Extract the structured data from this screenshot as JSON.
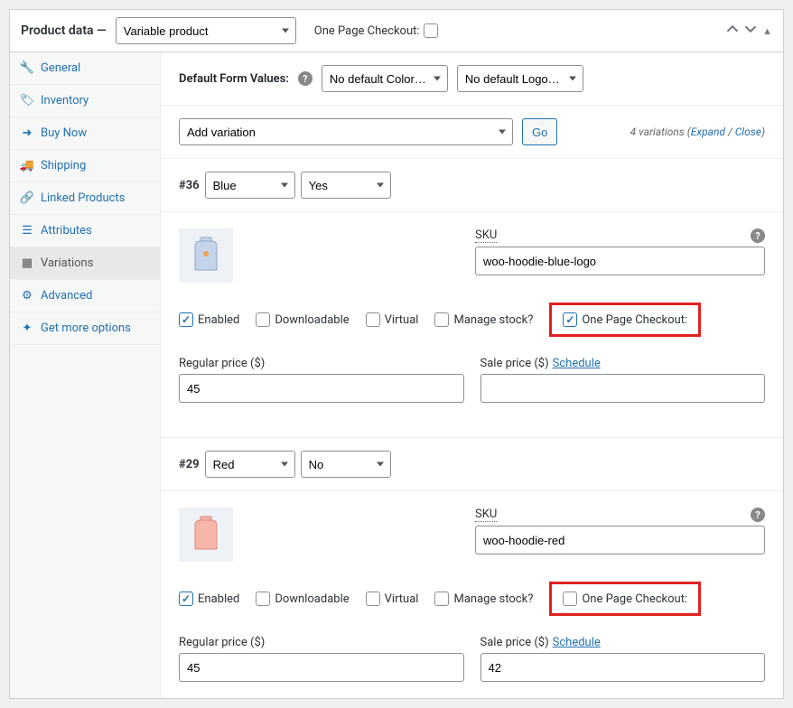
{
  "header": {
    "title_prefix": "Product data —",
    "product_type": "Variable product",
    "opc_label": "One Page Checkout:"
  },
  "sidebar": {
    "items": [
      {
        "label": "General"
      },
      {
        "label": "Inventory"
      },
      {
        "label": "Buy Now"
      },
      {
        "label": "Shipping"
      },
      {
        "label": "Linked Products"
      },
      {
        "label": "Attributes"
      },
      {
        "label": "Variations"
      },
      {
        "label": "Advanced"
      },
      {
        "label": "Get more options"
      }
    ]
  },
  "defaults": {
    "label": "Default Form Values:",
    "color_placeholder": "No default Color…",
    "logo_placeholder": "No default Logo…"
  },
  "add": {
    "placeholder": "Add variation",
    "go": "Go",
    "count_text": "4 variations",
    "expand": "Expand",
    "close": "Close"
  },
  "labels": {
    "sku": "SKU",
    "enabled": "Enabled",
    "downloadable": "Downloadable",
    "virtual": "Virtual",
    "manage_stock": "Manage stock?",
    "opc": "One Page Checkout:",
    "regular_price": "Regular price ($)",
    "sale_price": "Sale price ($)",
    "schedule": "Schedule"
  },
  "variations": [
    {
      "id": "#36",
      "color": "Blue",
      "logo": "Yes",
      "sku": "woo-hoodie-blue-logo",
      "enabled": true,
      "downloadable": false,
      "virtual": false,
      "manage_stock": false,
      "opc": true,
      "regular_price": "45",
      "sale_price": ""
    },
    {
      "id": "#29",
      "color": "Red",
      "logo": "No",
      "sku": "woo-hoodie-red",
      "enabled": true,
      "downloadable": false,
      "virtual": false,
      "manage_stock": false,
      "opc": false,
      "regular_price": "45",
      "sale_price": "42"
    }
  ]
}
